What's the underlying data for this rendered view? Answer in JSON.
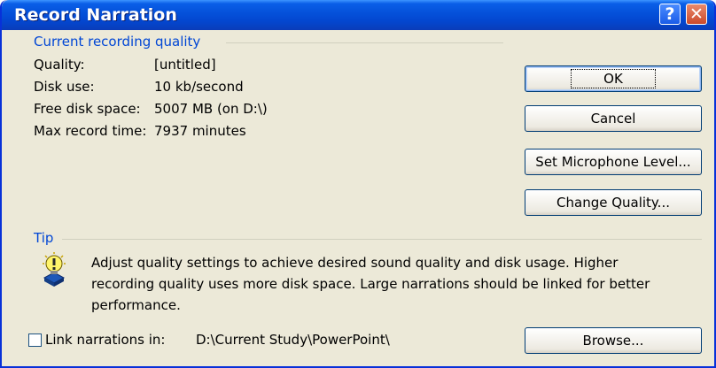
{
  "window": {
    "title": "Record Narration",
    "help_icon": "?",
    "close_icon": "✕"
  },
  "quality_group": {
    "heading": "Current recording quality",
    "rows": [
      {
        "label": "Quality:",
        "value": "[untitled]"
      },
      {
        "label": "Disk use:",
        "value": "10 kb/second"
      },
      {
        "label": "Free disk space:",
        "value": "5007 MB (on D:\\)"
      },
      {
        "label": "Max record time:",
        "value": "7937 minutes"
      }
    ]
  },
  "buttons": {
    "ok": "OK",
    "cancel": "Cancel",
    "mic_level": "Set Microphone Level...",
    "change_quality": "Change Quality...",
    "browse": "Browse..."
  },
  "tip": {
    "heading": "Tip",
    "text_lines": [
      "Adjust quality settings to achieve desired sound quality and disk usage. Higher",
      "recording quality uses more disk space. Large narrations should be linked for better",
      "performance."
    ]
  },
  "link": {
    "checkbox_label": "Link narrations in:",
    "checked": false,
    "path": "D:\\Current Study\\PowerPoint\\"
  },
  "colors": {
    "title_bar": "#0552db",
    "dialog_bg": "#ece9d8",
    "group_heading": "#0046d5"
  }
}
